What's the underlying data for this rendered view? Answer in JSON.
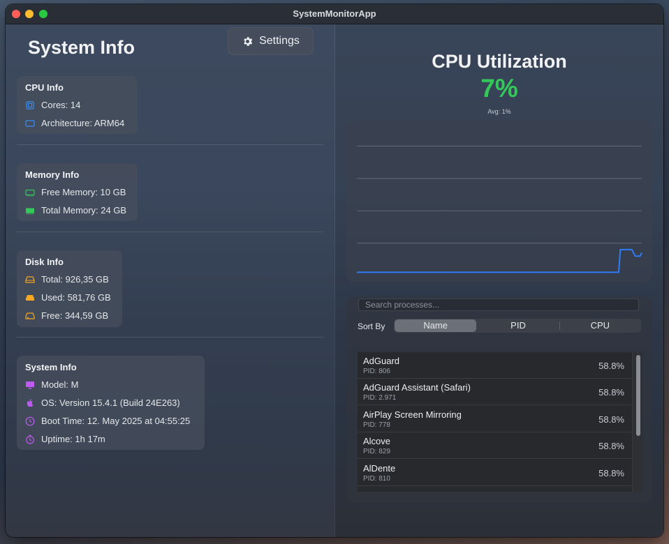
{
  "window": {
    "title": "SystemMonitorApp"
  },
  "left": {
    "title": "System Info",
    "settings_label": "Settings",
    "cpu_card": {
      "title": "CPU Info",
      "cores": "Cores: 14",
      "architecture": "Architecture: ARM64",
      "accent": "#3b8ff7"
    },
    "memory_card": {
      "title": "Memory Info",
      "free": "Free Memory: 10 GB",
      "total": "Total Memory: 24 GB",
      "accent": "#34c759"
    },
    "disk_card": {
      "title": "Disk Info",
      "total": "Total: 926,35 GB",
      "used": "Used: 581,76 GB",
      "free": "Free: 344,59 GB",
      "accent": "#f5a623"
    },
    "system_card": {
      "title": "System Info",
      "model": "Model: M",
      "os": "OS: Version 15.4.1 (Build 24E263)",
      "boot": "Boot Time: 12. May 2025 at 04:55:25",
      "uptime": "Uptime: 1h 17m",
      "accent": "#bf5af2"
    }
  },
  "right": {
    "cpu_title": "CPU Utilization",
    "cpu_value": "7%",
    "cpu_avg": "Avg: 1%",
    "search_placeholder": "Search processes...",
    "sort_by_label": "Sort By",
    "sort_options": [
      "Name",
      "PID",
      "CPU"
    ],
    "sort_selected": "Name",
    "processes": [
      {
        "name": "AdGuard",
        "pid": "PID: 806",
        "cpu": "58.8%"
      },
      {
        "name": "AdGuard Assistant (Safari)",
        "pid": "PID: 2.971",
        "cpu": "58.8%"
      },
      {
        "name": "AirPlay Screen Mirroring",
        "pid": "PID: 778",
        "cpu": "58.8%"
      },
      {
        "name": "Alcove",
        "pid": "PID: 829",
        "cpu": "58.8%"
      },
      {
        "name": "AlDente",
        "pid": "PID: 810",
        "cpu": "58.8%"
      }
    ]
  },
  "chart_data": {
    "type": "line",
    "title": "",
    "xlabel": "",
    "ylabel": "",
    "grid": true,
    "line_color": "#2f7cf6",
    "values": [
      1,
      1,
      1,
      1,
      1,
      1,
      1,
      1,
      1,
      1,
      1,
      1,
      1,
      1,
      1,
      1,
      1,
      1,
      1,
      1,
      1,
      1,
      1,
      1,
      1,
      1,
      1,
      1,
      1,
      1,
      1,
      1,
      1,
      1,
      1,
      1,
      1,
      1,
      1,
      1,
      1,
      1,
      1,
      1,
      1,
      1,
      1,
      1,
      1,
      1,
      1,
      1,
      1,
      1,
      1,
      1,
      1,
      1,
      1,
      1,
      1,
      1,
      1,
      1,
      1,
      1,
      1,
      1,
      1,
      1,
      1,
      1,
      1,
      1,
      1,
      1,
      1,
      1,
      1,
      1,
      1,
      1,
      1,
      1,
      1,
      1,
      1,
      1,
      1,
      1,
      1,
      1,
      1,
      1,
      1,
      1,
      1,
      1,
      1,
      1,
      1,
      1,
      1,
      1,
      1,
      1,
      1,
      1,
      1,
      1,
      1,
      1,
      1,
      1,
      1,
      1,
      1,
      1,
      1,
      1,
      1,
      1,
      1,
      1,
      1,
      1,
      1,
      1,
      1,
      1,
      1,
      1,
      1,
      1,
      1,
      1,
      1,
      1,
      1,
      1,
      1,
      1,
      1,
      1,
      1,
      1,
      1,
      1,
      1,
      1,
      1,
      1,
      1,
      1,
      1,
      1,
      1,
      1,
      1,
      1,
      8,
      8,
      8,
      8,
      8,
      8,
      8,
      8,
      7,
      6,
      6,
      6,
      6,
      7
    ],
    "ylim": [
      0,
      44
    ]
  }
}
